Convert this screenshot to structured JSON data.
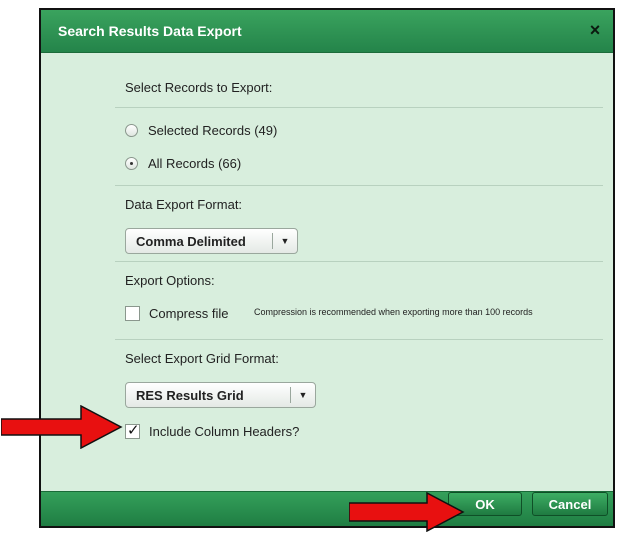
{
  "dialog": {
    "title": "Search Results Data Export",
    "close_label": "×"
  },
  "records": {
    "label": "Select Records to Export:",
    "options": [
      {
        "label": "Selected Records (49)",
        "checked": false
      },
      {
        "label": "All Records (66)",
        "checked": true
      }
    ]
  },
  "format": {
    "label": "Data Export Format:",
    "value": "Comma Delimited",
    "arrow": "▼"
  },
  "options": {
    "label": "Export Options:",
    "compress_label": "Compress file",
    "compress_checked": false,
    "compress_note": "Compression is recommended when exporting more than 100 records"
  },
  "grid": {
    "label": "Select Export Grid Format:",
    "value": "RES Results Grid",
    "arrow": "▼",
    "headers_label": "Include Column Headers?",
    "headers_checked": true,
    "check_glyph": "✓"
  },
  "footer": {
    "ok_label": "OK",
    "cancel_label": "Cancel"
  },
  "colors": {
    "accent": "#2a9450",
    "dialog_bg": "#d8eedd",
    "annotation_arrow": "#e81010"
  }
}
